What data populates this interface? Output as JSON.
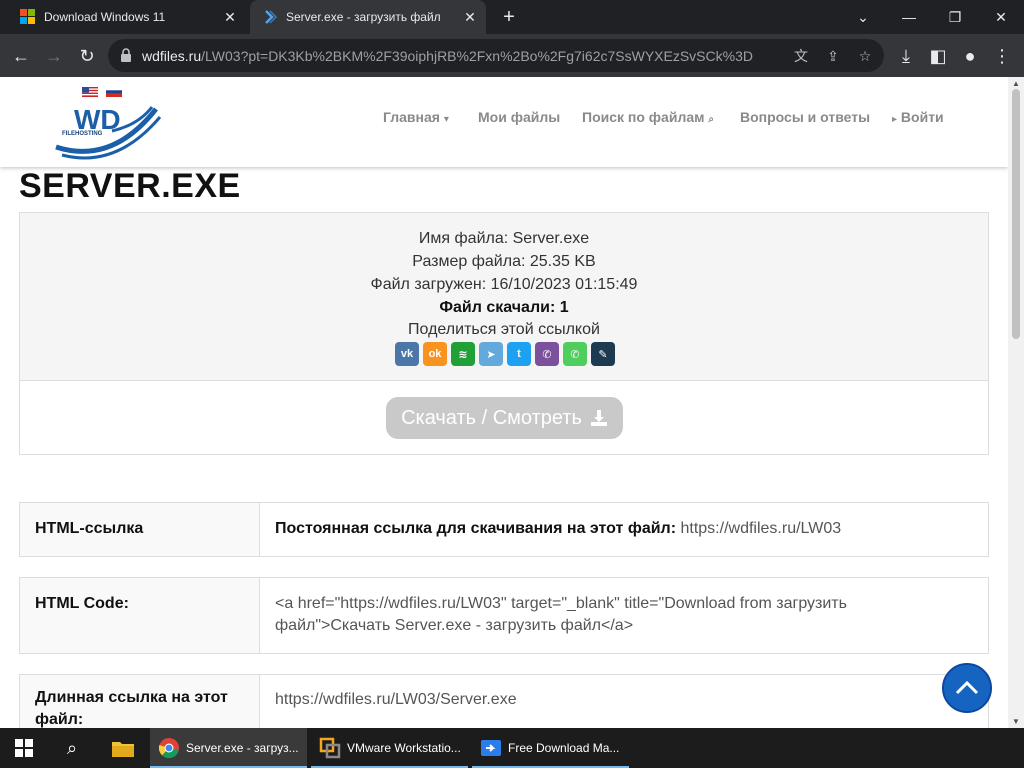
{
  "browser": {
    "tabs": [
      {
        "title": "Download Windows 11",
        "active": false
      },
      {
        "title": "Server.exe - загрузить файл",
        "active": true
      }
    ],
    "url_host": "wdfiles.ru",
    "url_path": "/LW03?pt=DK3Kb%2BKM%2F39oiphjRB%2Fxn%2Bo%2Fg7i62c7SsWYXEzSvSCk%3D"
  },
  "site": {
    "logo_text": "WD",
    "logo_sub": "FILEHOSTING",
    "nav": [
      {
        "label": "Главная",
        "suffix": "▾"
      },
      {
        "label": "Мои файлы",
        "suffix": ""
      },
      {
        "label": "Поиск по файлам",
        "suffix": "🔍"
      },
      {
        "label": "Вопросы и ответы",
        "suffix": ""
      },
      {
        "label": "Войти",
        "prefix": "▸"
      }
    ]
  },
  "file": {
    "heading": "SERVER.EXE",
    "name_line": "Имя файла: Server.exe",
    "size_line": "Размер файла: 25.35 KB",
    "uploaded_line": "Файл загружен: 16/10/2023 01:15:49",
    "downloads_line": "Файл скачали: 1",
    "share_label": "Поделиться этой ссылкой",
    "share_icons": [
      "vk-icon",
      "ok-icon",
      "sber-icon",
      "telegram-icon",
      "twitter-icon",
      "viber-icon",
      "whatsapp-icon",
      "livejournal-icon"
    ],
    "download_button": "Скачать / Смотреть"
  },
  "links": [
    {
      "label": "HTML-ссылка",
      "value_bold": "Постоянная ссылка для скачивания на этот файл:",
      "value": " https://wdfiles.ru/LW03"
    },
    {
      "label": "HTML Code:",
      "value_bold": "",
      "value": "<a href=\"https://wdfiles.ru/LW03\" target=\"_blank\" title=\"Download from загрузить файл\">Скачать Server.exe - загрузить файл</a>"
    },
    {
      "label": "Длинная ссылка на этот файл:",
      "value_bold": "",
      "value": "https://wdfiles.ru/LW03/Server.exe"
    }
  ],
  "taskbar": {
    "apps": [
      {
        "label": "Server.exe - загруз..."
      },
      {
        "label": "VMware Workstatio..."
      },
      {
        "label": "Free Download Ma..."
      }
    ]
  }
}
